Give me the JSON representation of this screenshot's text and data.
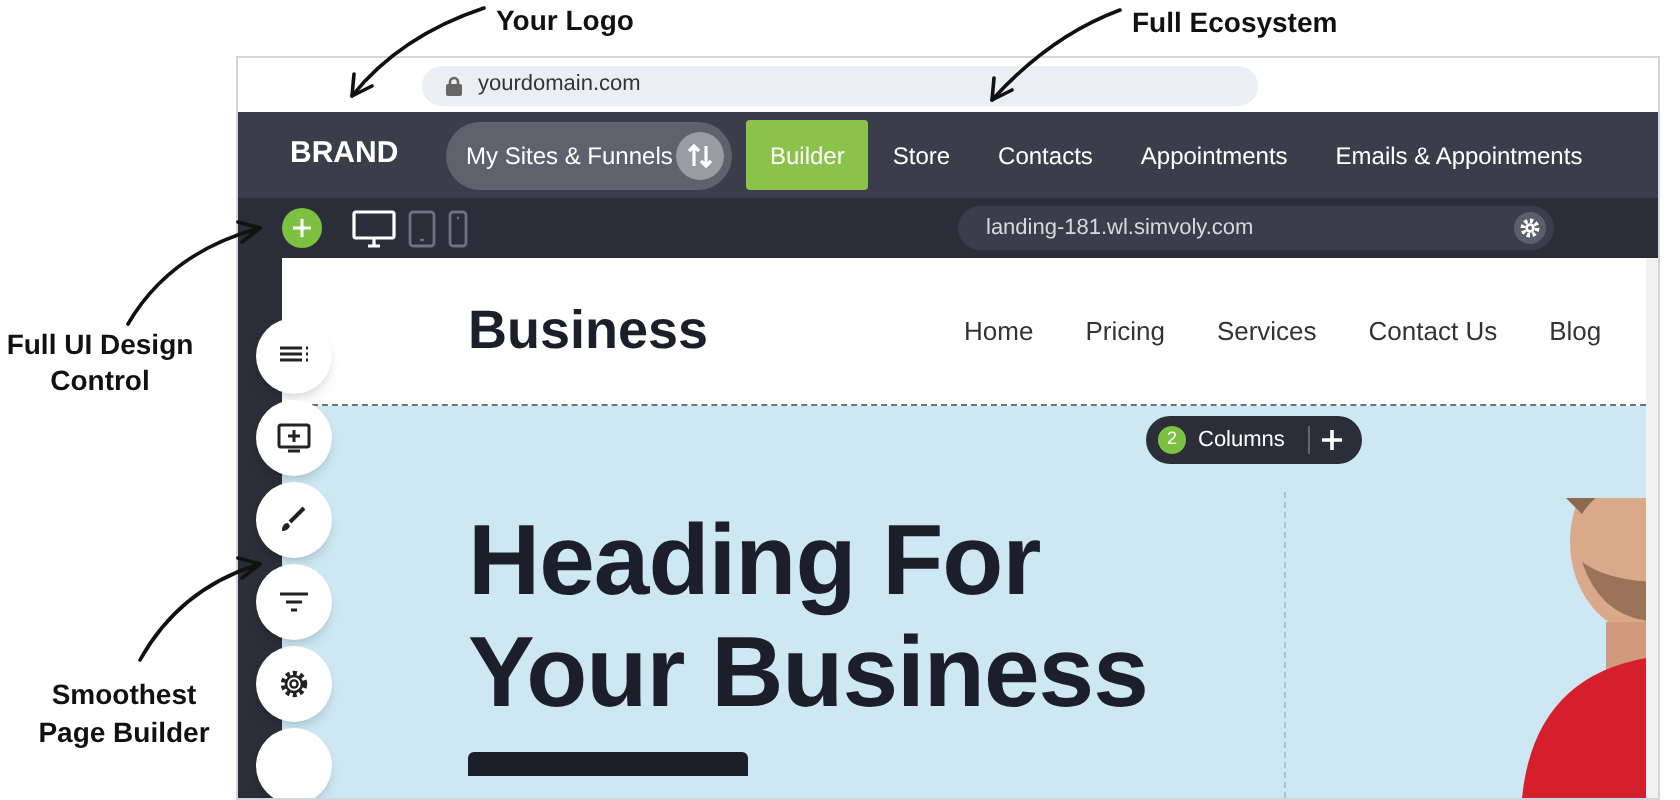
{
  "annotations": [
    {
      "text": "Your Logo"
    },
    {
      "text": "Full Ecosystem"
    },
    {
      "text": "Full UI Design Control"
    },
    {
      "text": "Smoothest Page Builder"
    }
  ],
  "browser": {
    "url": "yourdomain.com"
  },
  "nav": {
    "brand": "BRAND",
    "switcher": "My Sites & Funnels",
    "items": [
      {
        "label": "Builder",
        "selected": true
      },
      {
        "label": "Store",
        "selected": false
      },
      {
        "label": "Contacts",
        "selected": false
      },
      {
        "label": "Appointments",
        "selected": false
      },
      {
        "label": "Emails & Appointments",
        "selected": false
      }
    ]
  },
  "toolbar": {
    "devices": [
      {
        "kind": "desktop",
        "selected": true
      },
      {
        "kind": "tablet",
        "selected": false
      },
      {
        "kind": "phone",
        "selected": false
      }
    ],
    "domain": "landing-181.wl.simvoly.com"
  },
  "page": {
    "logo": "Business",
    "menu": [
      "Home",
      "Pricing",
      "Services",
      "Contact Us",
      "Blog"
    ],
    "columns_count": "2",
    "columns_label": "Columns",
    "heading": [
      "Heading For",
      "Your Business"
    ]
  }
}
